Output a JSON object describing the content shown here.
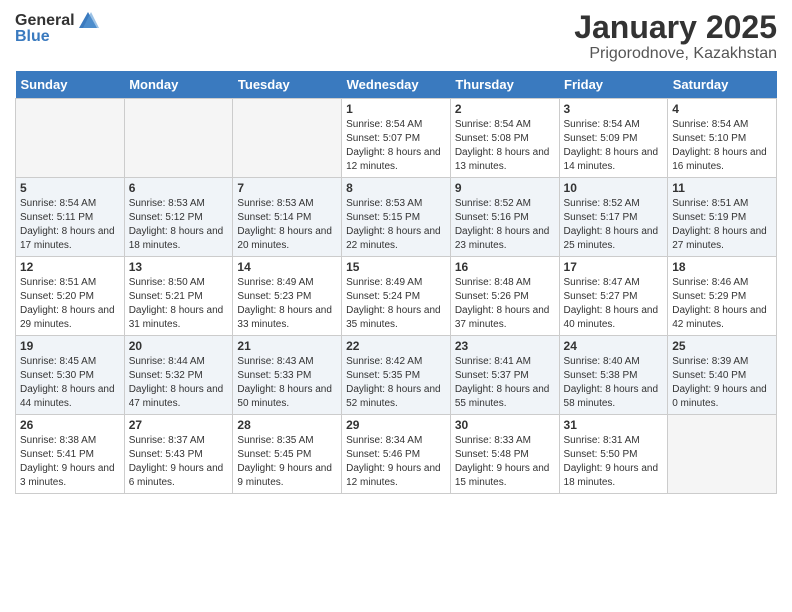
{
  "header": {
    "logo_general": "General",
    "logo_blue": "Blue",
    "month_title": "January 2025",
    "location": "Prigorodnove, Kazakhstan"
  },
  "days_of_week": [
    "Sunday",
    "Monday",
    "Tuesday",
    "Wednesday",
    "Thursday",
    "Friday",
    "Saturday"
  ],
  "weeks": [
    [
      {
        "num": "",
        "empty": true
      },
      {
        "num": "",
        "empty": true
      },
      {
        "num": "",
        "empty": true
      },
      {
        "num": "1",
        "sunrise": "8:54 AM",
        "sunset": "5:07 PM",
        "daylight": "8 hours and 12 minutes."
      },
      {
        "num": "2",
        "sunrise": "8:54 AM",
        "sunset": "5:08 PM",
        "daylight": "8 hours and 13 minutes."
      },
      {
        "num": "3",
        "sunrise": "8:54 AM",
        "sunset": "5:09 PM",
        "daylight": "8 hours and 14 minutes."
      },
      {
        "num": "4",
        "sunrise": "8:54 AM",
        "sunset": "5:10 PM",
        "daylight": "8 hours and 16 minutes."
      }
    ],
    [
      {
        "num": "5",
        "sunrise": "8:54 AM",
        "sunset": "5:11 PM",
        "daylight": "8 hours and 17 minutes."
      },
      {
        "num": "6",
        "sunrise": "8:53 AM",
        "sunset": "5:12 PM",
        "daylight": "8 hours and 18 minutes."
      },
      {
        "num": "7",
        "sunrise": "8:53 AM",
        "sunset": "5:14 PM",
        "daylight": "8 hours and 20 minutes."
      },
      {
        "num": "8",
        "sunrise": "8:53 AM",
        "sunset": "5:15 PM",
        "daylight": "8 hours and 22 minutes."
      },
      {
        "num": "9",
        "sunrise": "8:52 AM",
        "sunset": "5:16 PM",
        "daylight": "8 hours and 23 minutes."
      },
      {
        "num": "10",
        "sunrise": "8:52 AM",
        "sunset": "5:17 PM",
        "daylight": "8 hours and 25 minutes."
      },
      {
        "num": "11",
        "sunrise": "8:51 AM",
        "sunset": "5:19 PM",
        "daylight": "8 hours and 27 minutes."
      }
    ],
    [
      {
        "num": "12",
        "sunrise": "8:51 AM",
        "sunset": "5:20 PM",
        "daylight": "8 hours and 29 minutes."
      },
      {
        "num": "13",
        "sunrise": "8:50 AM",
        "sunset": "5:21 PM",
        "daylight": "8 hours and 31 minutes."
      },
      {
        "num": "14",
        "sunrise": "8:49 AM",
        "sunset": "5:23 PM",
        "daylight": "8 hours and 33 minutes."
      },
      {
        "num": "15",
        "sunrise": "8:49 AM",
        "sunset": "5:24 PM",
        "daylight": "8 hours and 35 minutes."
      },
      {
        "num": "16",
        "sunrise": "8:48 AM",
        "sunset": "5:26 PM",
        "daylight": "8 hours and 37 minutes."
      },
      {
        "num": "17",
        "sunrise": "8:47 AM",
        "sunset": "5:27 PM",
        "daylight": "8 hours and 40 minutes."
      },
      {
        "num": "18",
        "sunrise": "8:46 AM",
        "sunset": "5:29 PM",
        "daylight": "8 hours and 42 minutes."
      }
    ],
    [
      {
        "num": "19",
        "sunrise": "8:45 AM",
        "sunset": "5:30 PM",
        "daylight": "8 hours and 44 minutes."
      },
      {
        "num": "20",
        "sunrise": "8:44 AM",
        "sunset": "5:32 PM",
        "daylight": "8 hours and 47 minutes."
      },
      {
        "num": "21",
        "sunrise": "8:43 AM",
        "sunset": "5:33 PM",
        "daylight": "8 hours and 50 minutes."
      },
      {
        "num": "22",
        "sunrise": "8:42 AM",
        "sunset": "5:35 PM",
        "daylight": "8 hours and 52 minutes."
      },
      {
        "num": "23",
        "sunrise": "8:41 AM",
        "sunset": "5:37 PM",
        "daylight": "8 hours and 55 minutes."
      },
      {
        "num": "24",
        "sunrise": "8:40 AM",
        "sunset": "5:38 PM",
        "daylight": "8 hours and 58 minutes."
      },
      {
        "num": "25",
        "sunrise": "8:39 AM",
        "sunset": "5:40 PM",
        "daylight": "9 hours and 0 minutes."
      }
    ],
    [
      {
        "num": "26",
        "sunrise": "8:38 AM",
        "sunset": "5:41 PM",
        "daylight": "9 hours and 3 minutes."
      },
      {
        "num": "27",
        "sunrise": "8:37 AM",
        "sunset": "5:43 PM",
        "daylight": "9 hours and 6 minutes."
      },
      {
        "num": "28",
        "sunrise": "8:35 AM",
        "sunset": "5:45 PM",
        "daylight": "9 hours and 9 minutes."
      },
      {
        "num": "29",
        "sunrise": "8:34 AM",
        "sunset": "5:46 PM",
        "daylight": "9 hours and 12 minutes."
      },
      {
        "num": "30",
        "sunrise": "8:33 AM",
        "sunset": "5:48 PM",
        "daylight": "9 hours and 15 minutes."
      },
      {
        "num": "31",
        "sunrise": "8:31 AM",
        "sunset": "5:50 PM",
        "daylight": "9 hours and 18 minutes."
      },
      {
        "num": "",
        "empty": true
      }
    ]
  ],
  "labels": {
    "sunrise": "Sunrise:",
    "sunset": "Sunset:",
    "daylight": "Daylight:"
  }
}
